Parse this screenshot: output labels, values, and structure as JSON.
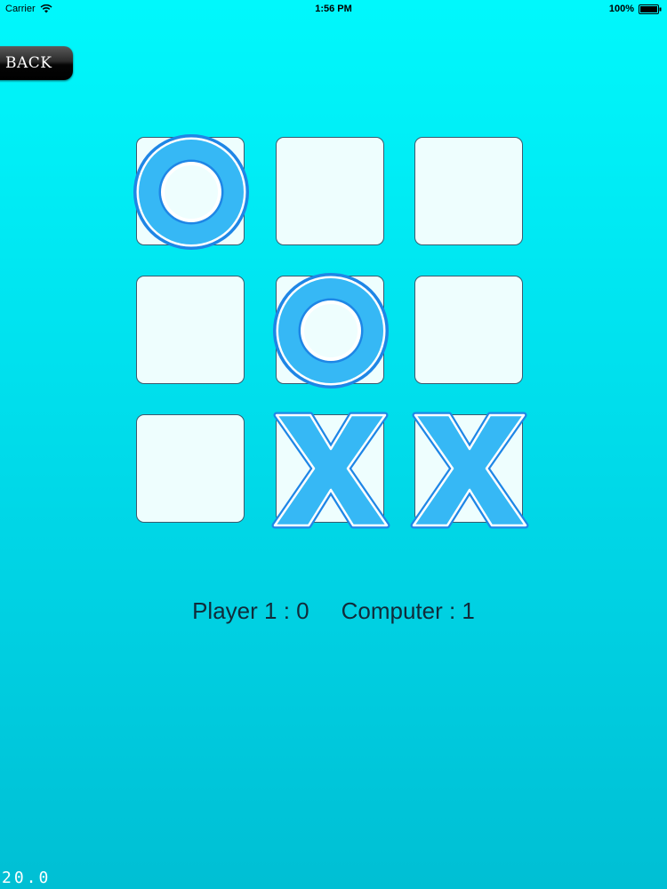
{
  "status_bar": {
    "carrier": "Carrier",
    "time": "1:56 PM",
    "battery": "100%"
  },
  "back_button": {
    "label": "BACK"
  },
  "board": {
    "cells": [
      "O",
      "",
      "",
      "",
      "O",
      "",
      "",
      "X",
      "X"
    ]
  },
  "score": {
    "player_label": "Player 1 : 0",
    "computer_label": "Computer : 1"
  },
  "fps": "20.0",
  "colors": {
    "mark_fill": "#36B8F5",
    "mark_outline": "#1E86E6"
  }
}
